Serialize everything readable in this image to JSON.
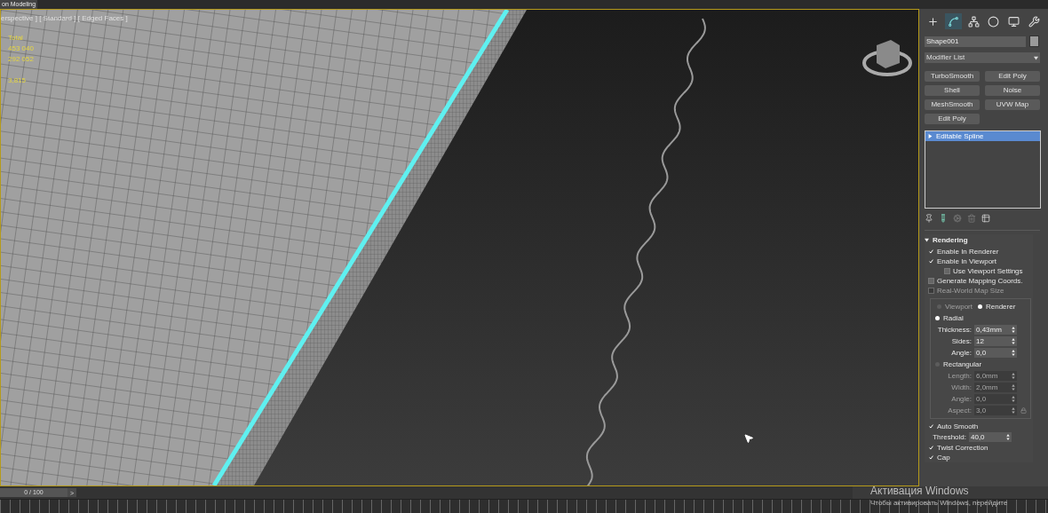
{
  "top_tab": {
    "label": "on Modeling"
  },
  "viewport": {
    "label": "erspective ] [ Standard ] [ Edged Faces ]",
    "stats": [
      "Total",
      "453 040",
      "292 052",
      "3,815"
    ]
  },
  "command_tabs": [
    {
      "kind": "create",
      "selected": false
    },
    {
      "kind": "modify",
      "selected": true
    },
    {
      "kind": "hierarchy",
      "selected": false
    },
    {
      "kind": "motion",
      "selected": false
    },
    {
      "kind": "display",
      "selected": false
    },
    {
      "kind": "utilities",
      "selected": false
    }
  ],
  "object_name": {
    "value": "Shape001",
    "color": "#9a9a9a"
  },
  "modifier_list": {
    "label": "Modifier List"
  },
  "modifier_buttons": [
    "TurboSmooth",
    "Edit Poly",
    "Shell",
    "Noise",
    "MeshSmooth",
    "UVW Map",
    "Edit Poly"
  ],
  "stack": [
    {
      "label": "Editable Spline",
      "selected": true
    }
  ],
  "rendering": {
    "title": "Rendering",
    "expanded": true,
    "items": [
      {
        "kind": "checkbox",
        "label": "Enable In Renderer",
        "checked": true,
        "disabled": false
      },
      {
        "kind": "checkbox",
        "label": "Enable In Viewport",
        "checked": true,
        "disabled": false
      },
      {
        "kind": "subcheckbox",
        "label": "Use Viewport Settings",
        "checked": false,
        "disabled": false
      },
      {
        "kind": "checkbox",
        "label": "Generate Mapping Coords.",
        "checked": false,
        "disabled": false
      },
      {
        "kind": "checkbox",
        "label": "Real-World Map Size",
        "checked": false,
        "disabled": true
      },
      {
        "kind": "group",
        "items": [
          {
            "kind": "radio_pair",
            "options": [
              {
                "label": "Viewport",
                "selected": false,
                "disabled": true
              },
              {
                "label": "Renderer",
                "selected": true,
                "disabled": false
              }
            ]
          },
          {
            "kind": "radio",
            "label": "Radial",
            "selected": true
          },
          {
            "kind": "spinner",
            "label": "Thickness:",
            "value": "0,43mm",
            "disabled": false
          },
          {
            "kind": "spinner",
            "label": "Sides:",
            "value": "12",
            "disabled": false
          },
          {
            "kind": "spinner",
            "label": "Angle:",
            "value": "0,0",
            "disabled": false
          },
          {
            "kind": "radio",
            "label": "Rectangular",
            "selected": false
          },
          {
            "kind": "spinner",
            "label": "Length:",
            "value": "6,0mm",
            "disabled": true
          },
          {
            "kind": "spinner",
            "label": "Width:",
            "value": "2,0mm",
            "disabled": true
          },
          {
            "kind": "spinner",
            "label": "Angle:",
            "value": "0,0",
            "disabled": true
          },
          {
            "kind": "spinner_lock",
            "label": "Aspect:",
            "value": "3,0",
            "disabled": true
          }
        ]
      },
      {
        "kind": "checkbox",
        "label": "Auto Smooth",
        "checked": true,
        "disabled": false
      },
      {
        "kind": "spinner",
        "label": "Threshold:",
        "value": "40,0",
        "disabled": false
      },
      {
        "kind": "checkbox",
        "label": "Twist Correction",
        "checked": true,
        "disabled": false
      },
      {
        "kind": "checkbox",
        "label": "Cap",
        "checked": true,
        "disabled": false
      }
    ]
  },
  "timeline": {
    "frame": "0 / 100",
    "level": 0,
    "next": ">"
  },
  "activation": {
    "title": "Активация Windows",
    "text": "Чтобы активировать Windows, перейдите"
  }
}
